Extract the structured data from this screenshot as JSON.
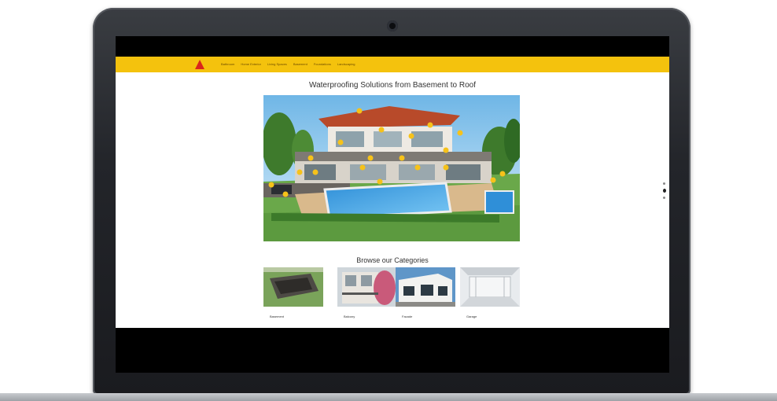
{
  "nav": {
    "items": [
      "Bathroom",
      "Home Exterior",
      "Living Spaces",
      "Basement",
      "Foundations",
      "Landscaping"
    ]
  },
  "hero": {
    "title": "Waterproofing Solutions from Basement to Roof"
  },
  "categories": {
    "title": "Browse our Categories",
    "items": [
      {
        "label": "Basement"
      },
      {
        "label": "Balcony"
      },
      {
        "label": "Facade"
      },
      {
        "label": "Garage"
      }
    ]
  },
  "colors": {
    "brand_yellow": "#f4c20d",
    "logo_red": "#d9261c",
    "hotspot": "#f6c21a"
  }
}
